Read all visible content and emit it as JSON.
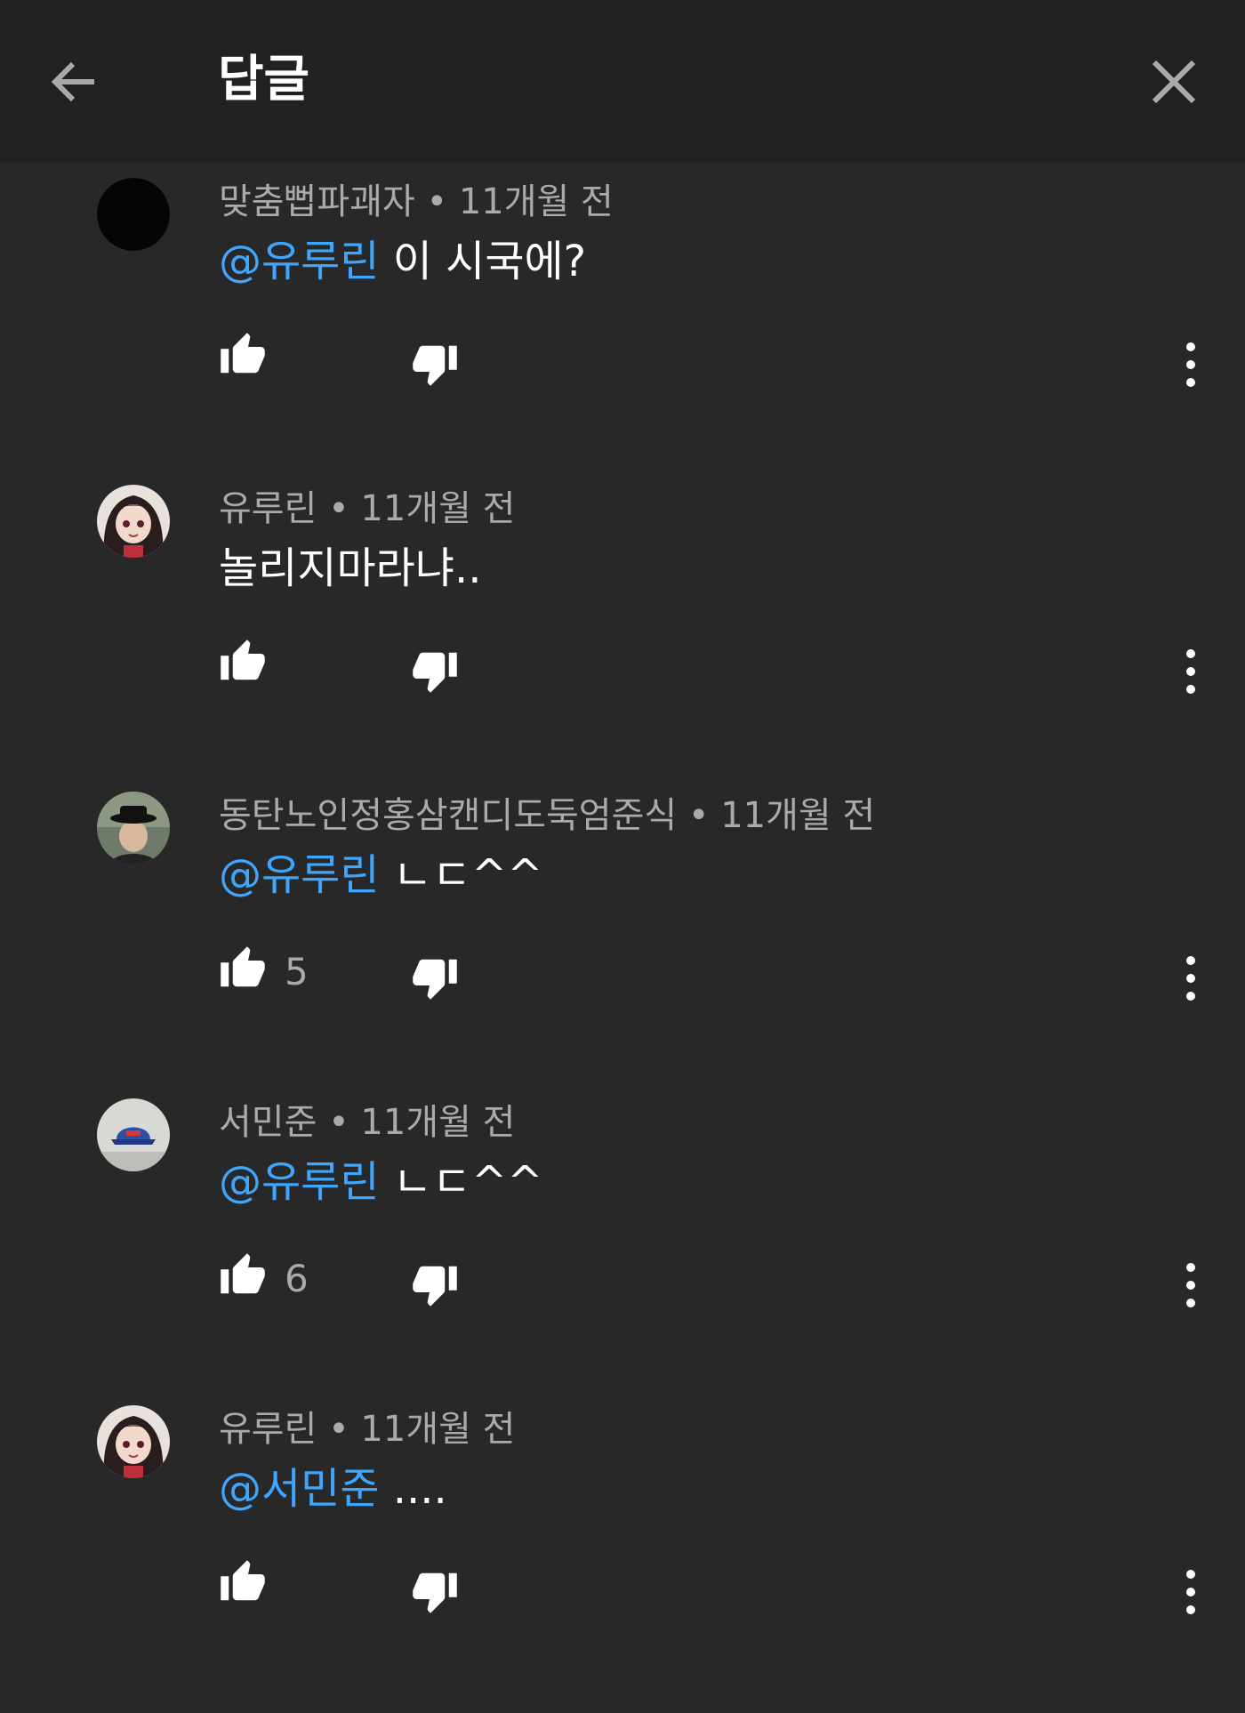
{
  "header": {
    "title": "답글",
    "back_icon": "arrow-left-icon",
    "close_icon": "close-icon"
  },
  "colors": {
    "background": "#282828",
    "header_background": "#212121",
    "mention": "#3ea6ff",
    "meta_text": "#aaaaaa",
    "icon": "#ffffff"
  },
  "comments": [
    {
      "author": "맞춤뻡파괘자",
      "meta": "맞춤뻡파괘자 • 11개월 전",
      "mention": "@유루린",
      "text": " 이 시국에?",
      "likes": "",
      "avatar": "black-circle-avatar"
    },
    {
      "author": "유루린",
      "meta": "유루린 • 11개월 전",
      "mention": "",
      "text": "놀리지마라냐..",
      "likes": "",
      "avatar": "anime-girl-avatar"
    },
    {
      "author": "동탄노인정홍삼캔디도둑엄준식",
      "meta": "동탄노인정홍삼캔디도둑엄준식 • 11개월 전",
      "mention": "@유루린",
      "text": " ㄴㄷ^^",
      "likes": "5",
      "avatar": "person-with-hat-avatar"
    },
    {
      "author": "서민준",
      "meta": "서민준 • 11개월 전",
      "mention": "@유루린",
      "text": " ㄴㄷ^^",
      "likes": "6",
      "avatar": "cap-photo-avatar"
    },
    {
      "author": "유루린",
      "meta": "유루린 • 11개월 전",
      "mention": "@서민준",
      "text": " ....",
      "likes": "",
      "avatar": "anime-girl-avatar"
    }
  ]
}
